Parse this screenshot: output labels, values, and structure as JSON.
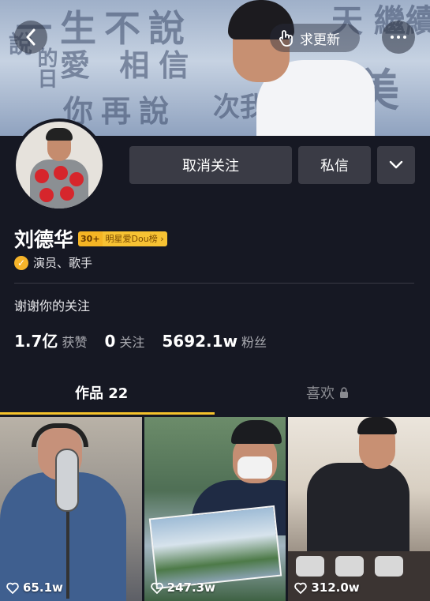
{
  "header": {
    "update_label": "求更新",
    "banner_text": [
      "一生不說",
      "愛 相信",
      "你再說",
      "天 繼續",
      "美",
      "次我",
      "說",
      "的日"
    ]
  },
  "actions": {
    "unfollow_label": "取消关注",
    "message_label": "私信"
  },
  "profile": {
    "name": "刘德华",
    "rank_number": "30+",
    "rank_label": "明星爱Dou榜",
    "verified_text": "演员、歌手",
    "bio": "谢谢你的关注"
  },
  "stats": [
    {
      "value": "1.7亿",
      "label": "获赞"
    },
    {
      "value": "0",
      "label": "关注"
    },
    {
      "value": "5692.1w",
      "label": "粉丝"
    }
  ],
  "tabs": {
    "works_label": "作品 22",
    "likes_label": "喜欢"
  },
  "videos": [
    {
      "likes": "65.1w"
    },
    {
      "likes": "247.3w"
    },
    {
      "likes": "312.0w"
    }
  ],
  "colors": {
    "background": "#161823",
    "accent_yellow": "#f5c22b",
    "button_gray": "#3a3b45",
    "verify_badge": "#f6b42a"
  }
}
